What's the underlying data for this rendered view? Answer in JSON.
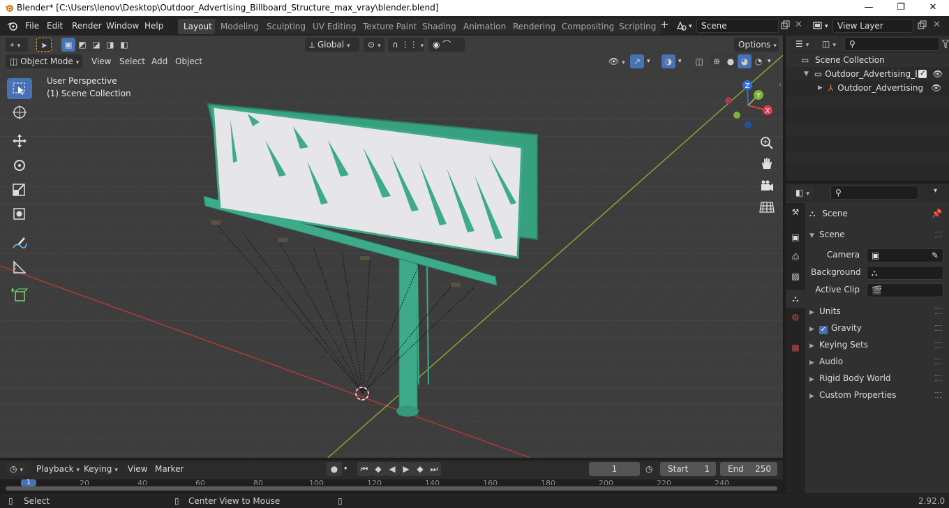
{
  "titlebar": {
    "title": "Blender* [C:\\Users\\lenov\\Desktop\\Outdoor_Advertising_Billboard_Structure_max_vray\\blender.blend]",
    "minimize": "—",
    "maximize": "❐",
    "close": "✕"
  },
  "menu": {
    "file": "File",
    "edit": "Edit",
    "render": "Render",
    "window": "Window",
    "help": "Help"
  },
  "workspaces": [
    {
      "label": "Layout",
      "active": true
    },
    {
      "label": "Modeling"
    },
    {
      "label": "Sculpting"
    },
    {
      "label": "UV Editing"
    },
    {
      "label": "Texture Paint"
    },
    {
      "label": "Shading"
    },
    {
      "label": "Animation"
    },
    {
      "label": "Rendering"
    },
    {
      "label": "Compositing"
    },
    {
      "label": "Scripting"
    }
  ],
  "topright": {
    "add_ws": "+",
    "scene_name": "Scene",
    "view_layer": "View Layer"
  },
  "viewport": {
    "transform_orientation": "Global",
    "options": "Options",
    "mode": "Object Mode",
    "view": "View",
    "select": "Select",
    "add": "Add",
    "object": "Object",
    "perspective_label": "User Perspective",
    "collection_label": "(1) Scene Collection",
    "gizmo": {
      "x": "X",
      "y": "Y",
      "z": "Z"
    }
  },
  "outliner": {
    "root": "Scene Collection",
    "items": [
      {
        "label": "Outdoor_Advertising_Bill",
        "level": 1
      },
      {
        "label": "Outdoor_Advertising",
        "level": 2
      }
    ]
  },
  "properties": {
    "header": "Scene",
    "panel": "Scene",
    "camera_label": "Camera",
    "background_label": "Background ...",
    "active_clip_label": "Active Clip",
    "sections": [
      "Units",
      "Gravity",
      "Keying Sets",
      "Audio",
      "Rigid Body World",
      "Custom Properties"
    ]
  },
  "timeline": {
    "playback": "Playback",
    "keying": "Keying",
    "view": "View",
    "marker": "Marker",
    "current_frame": "1",
    "start_label": "Start",
    "start_value": "1",
    "end_label": "End",
    "end_value": "250",
    "ruler": [
      "1",
      "20",
      "40",
      "60",
      "80",
      "100",
      "120",
      "140",
      "160",
      "180",
      "200",
      "220",
      "240"
    ]
  },
  "status": {
    "select": "Select",
    "center_view": "Center View to Mouse",
    "version": "2.92.0"
  },
  "colors": {
    "accent": "#4772b3",
    "billboard_green": "#3daa8a",
    "axis_red": "#b03a3a",
    "axis_green": "#8aa432"
  }
}
